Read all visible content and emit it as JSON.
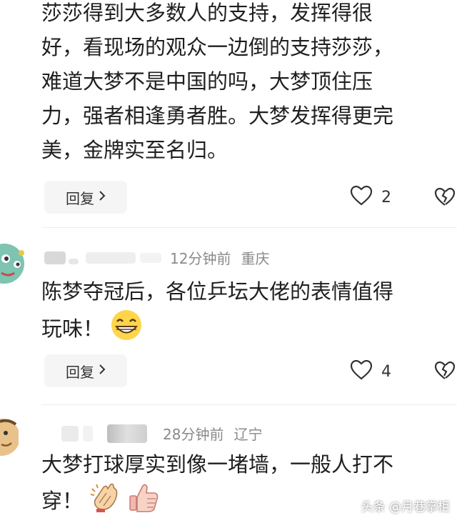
{
  "comments": [
    {
      "text_lines": [
        "莎莎得到大多数人的支持，发挥得很",
        "好，看现场的观众一边倒的支持莎莎，",
        "难道大梦不是中国的吗，大梦顶住压",
        "力，强者相逢勇者胜。大梦发挥得更完",
        "美，金牌实至名归。"
      ],
      "reply_label": "回复",
      "like_count": "2"
    },
    {
      "time": "12分钟前",
      "location": "重庆",
      "text_lines": [
        "陈梦夺冠后，各位乒坛大佬的表情值得",
        "玩味！"
      ],
      "emoji": "grinning-face-emoji",
      "reply_label": "回复",
      "like_count": "4"
    },
    {
      "time": "28分钟前",
      "location": "辽宁",
      "text_lines": [
        "大梦打球厚实到像一堵墙，一般人打不",
        "穿！"
      ],
      "emojis": [
        "clapping-hands-emoji",
        "thumbs-up-emoji"
      ]
    }
  ],
  "watermark": "头条 @月巷掌柜",
  "icons": {
    "like": "heart-icon",
    "dislike": "broken-heart-icon",
    "chevron": "chevron-right-icon"
  }
}
